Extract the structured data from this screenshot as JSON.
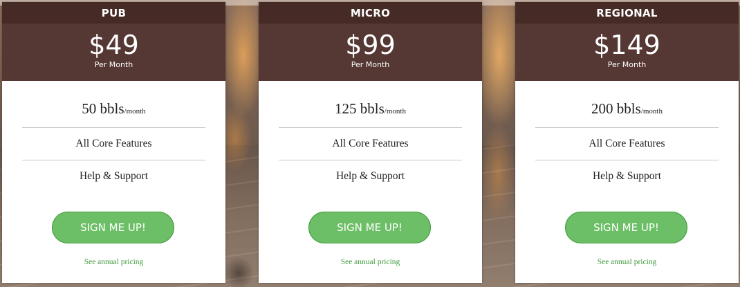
{
  "plans": [
    {
      "name": "PUB",
      "price": "$49",
      "per": "Per Month",
      "volume": "50 bbls",
      "unit": "/month",
      "feature_core": "All Core Features",
      "feature_support": "Help & Support",
      "cta": "SIGN ME UP!",
      "annual_link": "See annual pricing"
    },
    {
      "name": "MICRO",
      "price": "$99",
      "per": "Per Month",
      "volume": "125 bbls",
      "unit": "/month",
      "feature_core": "All Core Features",
      "feature_support": "Help & Support",
      "cta": "SIGN ME UP!",
      "annual_link": "See annual pricing"
    },
    {
      "name": "REGIONAL",
      "price": "$149",
      "per": "Per Month",
      "volume": "200 bbls",
      "unit": "/month",
      "feature_core": "All Core Features",
      "feature_support": "Help & Support",
      "cta": "SIGN ME UP!",
      "annual_link": "See annual pricing"
    }
  ],
  "colors": {
    "header": "#462a26",
    "price_box": "#553733",
    "button": "#6cbf66",
    "link": "#3f9a3a"
  }
}
